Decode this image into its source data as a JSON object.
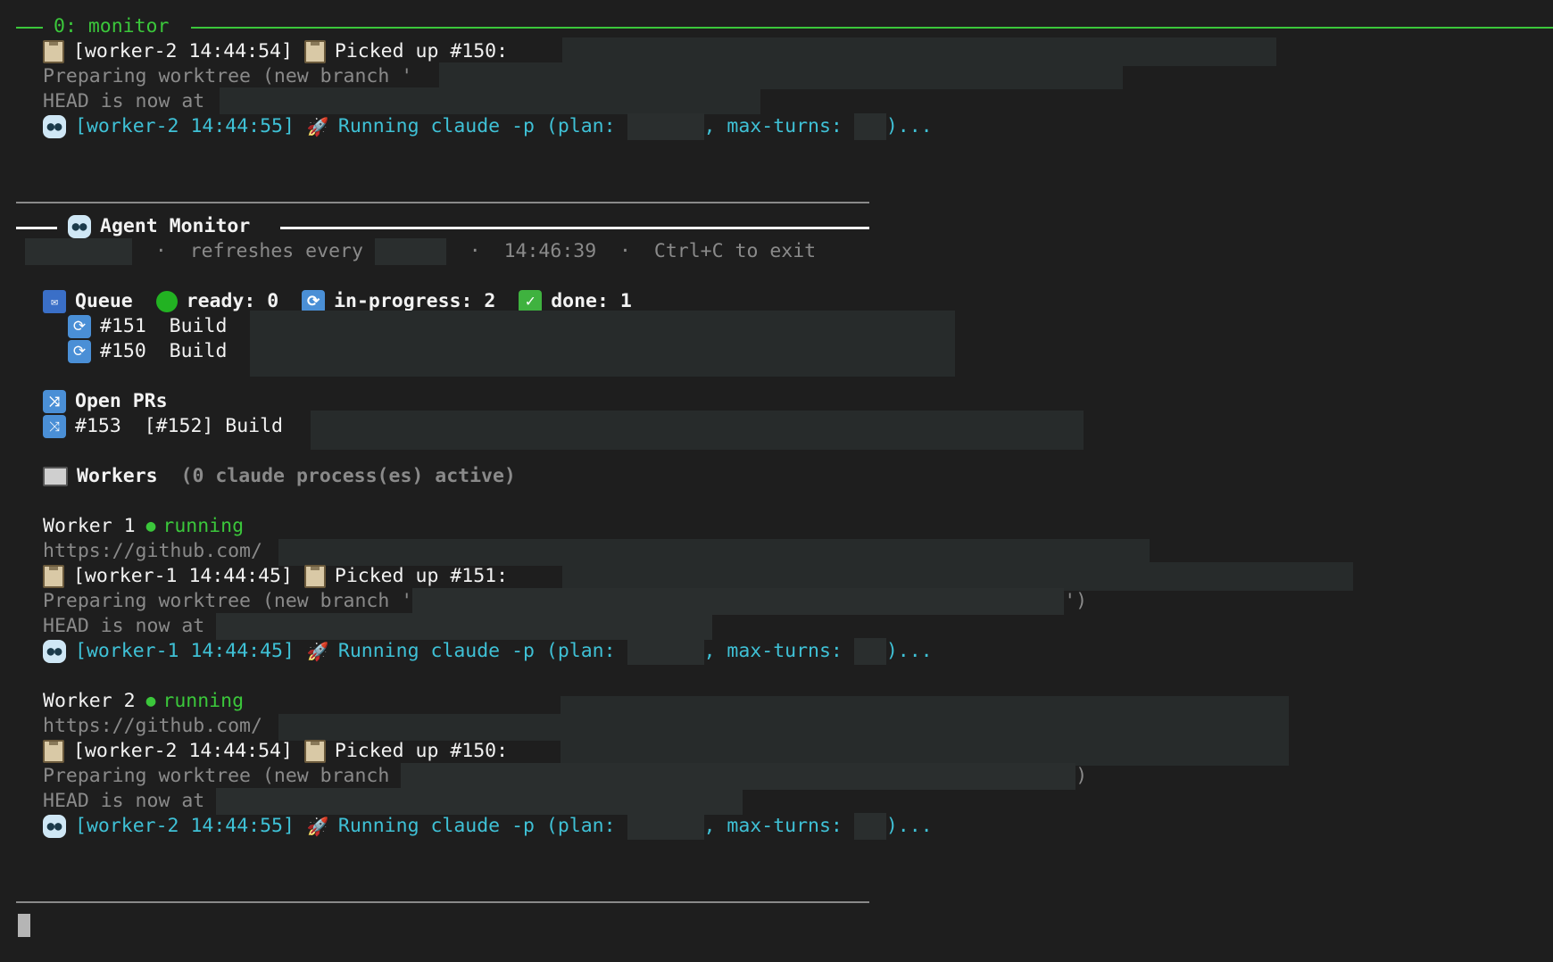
{
  "pane": {
    "title": "0: monitor"
  },
  "top_log": {
    "line1": {
      "worker": "[worker-2 14:44:54]",
      "text": "Picked up #150:"
    },
    "line2": {
      "text": "Preparing worktree (new branch '"
    },
    "line3": {
      "text": "HEAD is now at"
    },
    "line4": {
      "worker": "[worker-2 14:44:55]",
      "text": "Running claude -p (plan:",
      "sep": ", max-turns:",
      "end": ")..."
    }
  },
  "monitor": {
    "title": "Agent Monitor",
    "refresh_text": "refreshes every",
    "sep": "·",
    "time": "14:46:39",
    "exit_hint": "Ctrl+C to exit"
  },
  "queue": {
    "label": "Queue",
    "ready": "ready: 0",
    "in_progress": "in-progress: 2",
    "done": "done: 1",
    "items": [
      {
        "num": "#151",
        "title": "Build"
      },
      {
        "num": "#150",
        "title": "Build"
      }
    ]
  },
  "prs": {
    "label": "Open PRs",
    "items": [
      {
        "text": "#153  [#152] Build"
      }
    ]
  },
  "workers": {
    "label": "Workers",
    "active": "(0 claude process(es) active)",
    "list": [
      {
        "name": "Worker 1",
        "status": "running",
        "url": "https://github.com/",
        "picked_worker": "[worker-1 14:44:45]",
        "picked_text": "Picked up #151:",
        "prep_text": "Preparing worktree (new branch '",
        "prep_end": "')",
        "head_text": "HEAD is now at",
        "run_worker": "[worker-1 14:44:45]",
        "run_text": "Running claude -p (plan:",
        "run_sep": ", max-turns:",
        "run_end": ")..."
      },
      {
        "name": "Worker 2",
        "status": "running",
        "url": "https://github.com/",
        "picked_worker": "[worker-2 14:44:54]",
        "picked_text": "Picked up #150:",
        "prep_text": "Preparing worktree (new branch",
        "prep_end": ")",
        "head_text": "HEAD is now at",
        "run_worker": "[worker-2 14:44:55]",
        "run_text": "Running claude -p (plan:",
        "run_sep": ", max-turns:",
        "run_end": ")..."
      }
    ]
  },
  "colors": {
    "background": "#1e1e1e",
    "green": "#3bc73b",
    "cyan": "#3fc1d6",
    "dim": "#8a8a8a"
  }
}
